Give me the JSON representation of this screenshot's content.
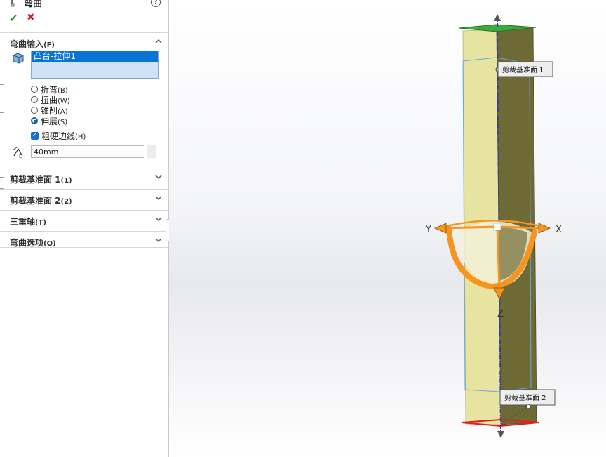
{
  "feature": {
    "title": "弯曲",
    "help": "?",
    "ok": "✔",
    "cancel": "✖"
  },
  "sections": {
    "input": {
      "label": "弯曲输入",
      "key": "(F)"
    },
    "bodies": {
      "selected_item": "凸台-拉伸1"
    },
    "modes": [
      {
        "label": "折弯",
        "key": "(B)",
        "selected": false
      },
      {
        "label": "扭曲",
        "key": "(W)",
        "selected": false
      },
      {
        "label": "锥削",
        "key": "(A)",
        "selected": false
      },
      {
        "label": "伸展",
        "key": "(S)",
        "selected": true
      }
    ],
    "hard_edges": {
      "label": "粗硬边线",
      "key": "(H)",
      "checked": true
    },
    "distance": {
      "value": "40mm"
    },
    "trim_plane1": {
      "label": "剪裁基准面 1",
      "key": "(1)"
    },
    "trim_plane2": {
      "label": "剪裁基准面 2",
      "key": "(2)"
    },
    "triad": {
      "label": "三重轴",
      "key": "(T)"
    },
    "options": {
      "label": "弯曲选项",
      "key": "(O)"
    }
  },
  "viewport": {
    "callout1": "剪裁基准面 1",
    "callout2": "剪裁基准面 2",
    "axis_x": "X",
    "axis_y": "Y",
    "axis_z": "Z"
  },
  "colors": {
    "accent": "#0a74d6",
    "ok": "#1e9a2a",
    "cancel": "#d0202a",
    "body_front": "#e6e4a0",
    "body_side": "#6e6a35",
    "triad": "#f7941d",
    "plane_top": "#2e9a2e",
    "plane_bottom": "#e02020"
  }
}
